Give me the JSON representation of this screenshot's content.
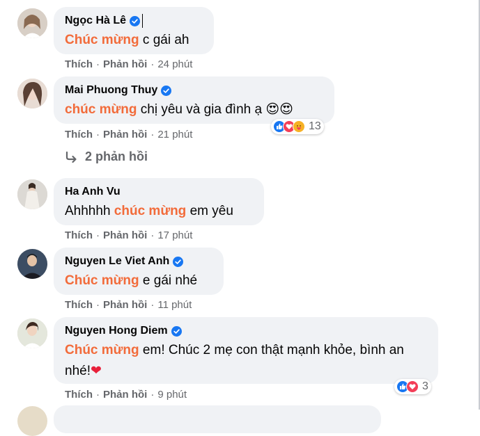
{
  "comments": [
    {
      "name": "Ngọc Hà Lê",
      "verified": true,
      "text_highlight": "Chúc mừng",
      "text_rest": " c gái ah",
      "like": "Thích",
      "reply": "Phản hồi",
      "time": "24 phút"
    },
    {
      "name": "Mai Phuong Thuy",
      "verified": true,
      "text_highlight": "chúc mừng",
      "text_rest": " chị yêu và gia đình ạ 😍😍",
      "like": "Thích",
      "reply": "Phản hồi",
      "time": "21 phút",
      "reaction_count": "13",
      "replies_label": "2 phản hồi"
    },
    {
      "name": "Ha Anh Vu",
      "verified": false,
      "text_before": "Ahhhhh ",
      "text_highlight": "chúc mừng",
      "text_rest": " em yêu",
      "like": "Thích",
      "reply": "Phản hồi",
      "time": "17 phút"
    },
    {
      "name": "Nguyen Le Viet Anh",
      "verified": true,
      "text_highlight": "Chúc mừng",
      "text_rest": " e gái nhé",
      "like": "Thích",
      "reply": "Phản hồi",
      "time": "11 phút"
    },
    {
      "name": "Nguyen Hong Diem",
      "verified": true,
      "text_highlight": "Chúc mừng",
      "text_rest": " em! Chúc 2 mẹ con thật mạnh khỏe, bình an nhé!",
      "like": "Thích",
      "reply": "Phản hồi",
      "time": "9 phút",
      "reaction_count": "3"
    }
  ],
  "separator": "·",
  "colors": {
    "highlight": "#f26b3a",
    "bubble": "#f0f2f5",
    "meta": "#65676b",
    "verified": "#1877f2",
    "like": "#1877f2",
    "love": "#f33e58",
    "care": "#f7b125"
  }
}
